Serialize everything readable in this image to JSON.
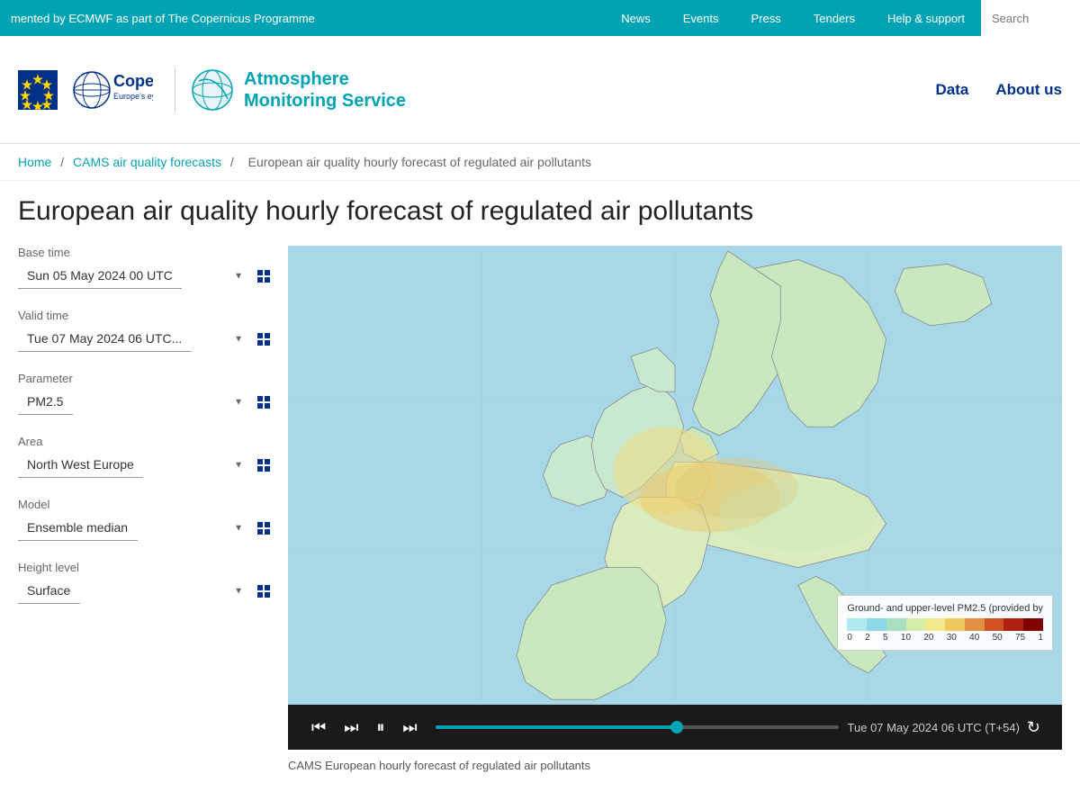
{
  "topbar": {
    "left_text": "mented by ECMWF as part of The Copernicus Programme",
    "news": "News",
    "events": "Events",
    "press": "Press",
    "tenders": "Tenders",
    "help": "Help & support",
    "search_placeholder": "Search"
  },
  "header": {
    "copernicus": "Copernicus",
    "copernicus_subtitle": "Europe's eyes on Earth",
    "ams_line1": "Atmosphere",
    "ams_line2": "Monitoring Service",
    "nav_data": "Data",
    "nav_about": "About us"
  },
  "breadcrumb": {
    "home": "Home",
    "cams": "CAMS air quality forecasts",
    "current": "European air quality hourly forecast of regulated air pollutants"
  },
  "page": {
    "title": "European air quality hourly forecast of regulated air pollutants"
  },
  "controls": {
    "base_time_label": "Base time",
    "base_time_value": "Sun 05 May 2024 00 UTC",
    "valid_time_label": "Valid time",
    "valid_time_value": "Tue 07 May 2024 06 UTC...",
    "parameter_label": "Parameter",
    "parameter_value": "PM2.5",
    "area_label": "Area",
    "area_value": "North West Europe",
    "model_label": "Model",
    "model_value": "Ensemble median",
    "height_label": "Height level",
    "height_value": "Surface"
  },
  "playback": {
    "time_display": "Tue 07 May 2024 06 UTC (T+54)",
    "progress_percent": 60
  },
  "legend": {
    "title": "Ground- and upper-level PM2.5 (provided by",
    "labels": [
      "0",
      "2",
      "5",
      "10",
      "20",
      "30",
      "40",
      "50",
      "75",
      "1"
    ],
    "colors": [
      "#b0e8f0",
      "#8dd8e8",
      "#aadec0",
      "#d4eda8",
      "#f0e88a",
      "#f0c860",
      "#e09040",
      "#d05020",
      "#b02010",
      "#800000"
    ]
  },
  "caption": "CAMS European hourly forecast of regulated air pollutants"
}
